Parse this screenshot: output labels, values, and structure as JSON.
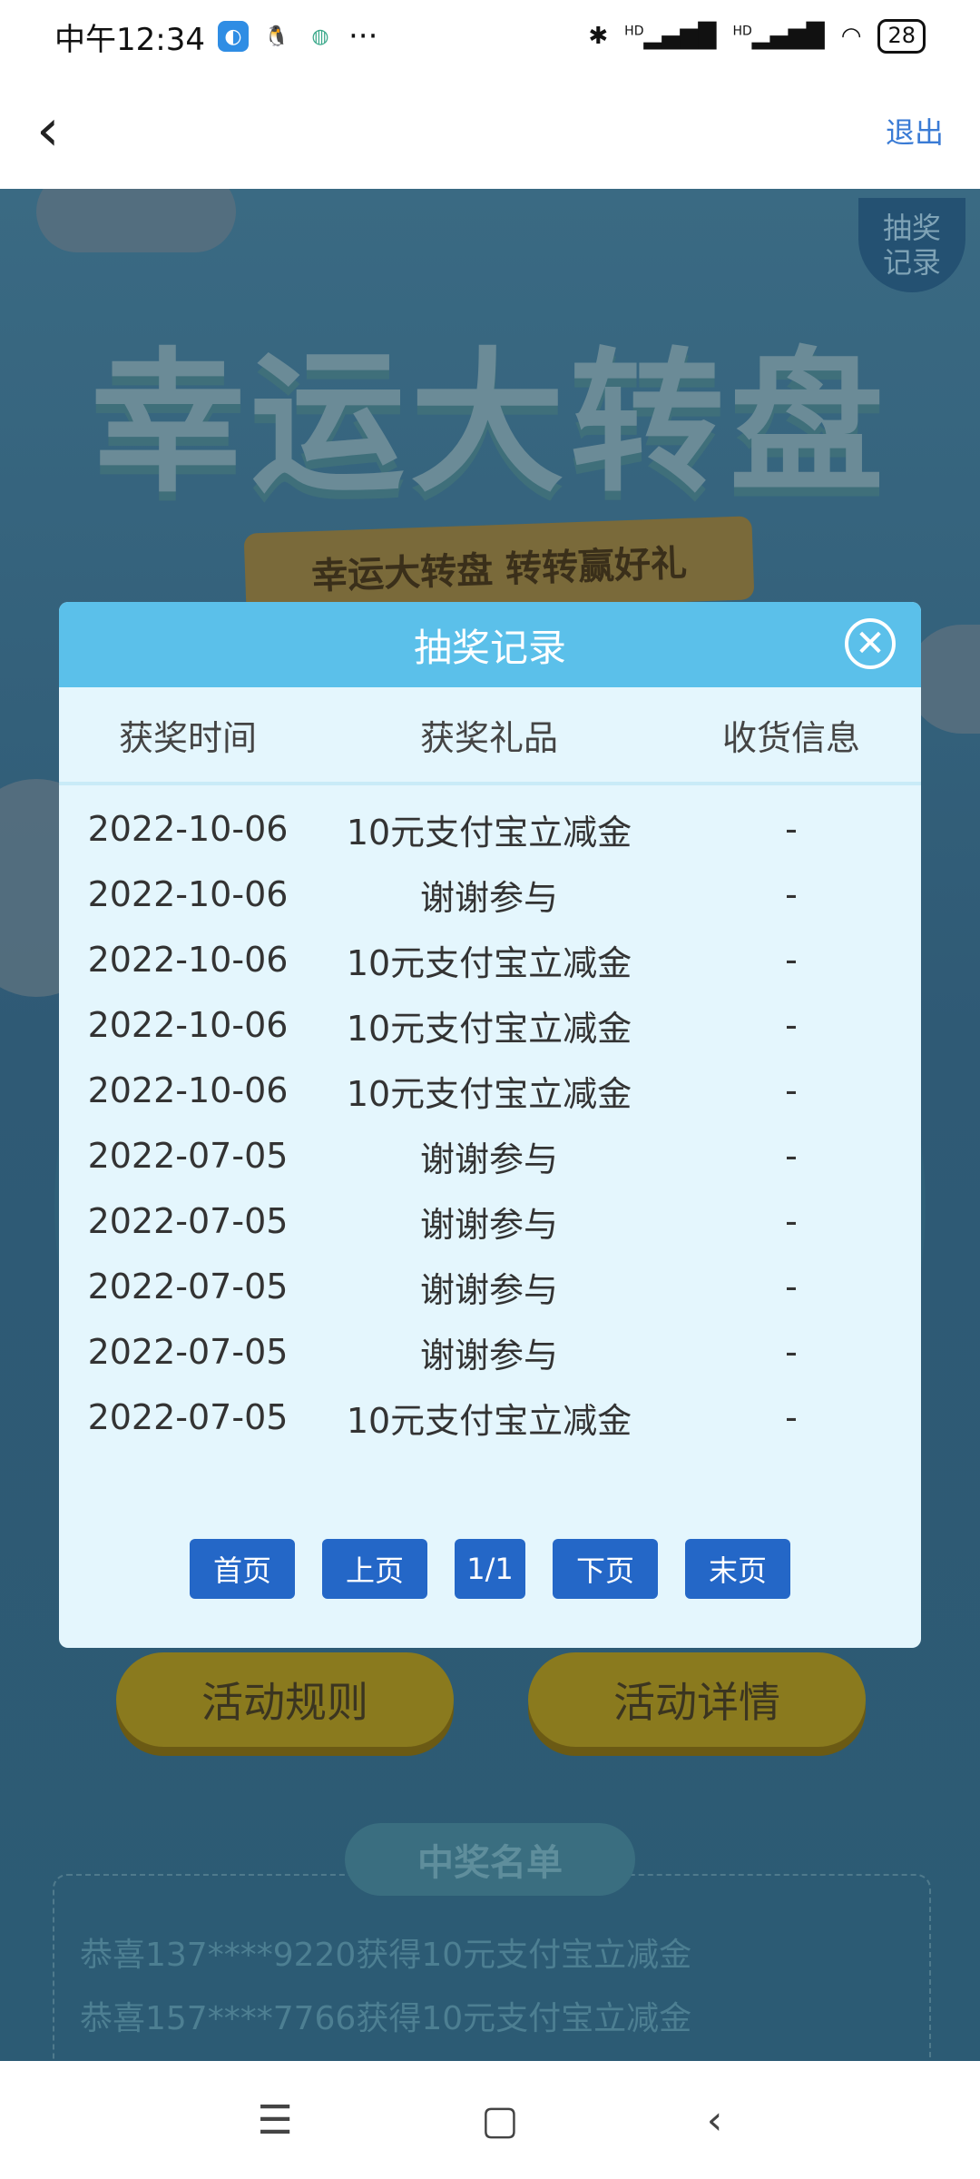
{
  "status_bar": {
    "time": "中午12:34",
    "more": "···",
    "battery": "28",
    "hd1": "HD",
    "hd2": "HD"
  },
  "header": {
    "back_icon": "‹",
    "exit_label": "退出"
  },
  "background": {
    "record_corner": "抽奖\n记录",
    "title": "幸运大转盘",
    "ribbon": "幸运大转盘 转转赢好礼",
    "rules_button": "活动规则",
    "details_button": "活动详情",
    "winners_title": "中奖名单",
    "winners": [
      "恭喜137****9220获得10元支付宝立减金",
      "恭喜157****7766获得10元支付宝立减金"
    ]
  },
  "modal": {
    "title": "抽奖记录",
    "columns": [
      "获奖时间",
      "获奖礼品",
      "收货信息"
    ],
    "rows": [
      [
        "2022-10-06",
        "10元支付宝立减金",
        "-"
      ],
      [
        "2022-10-06",
        "谢谢参与",
        "-"
      ],
      [
        "2022-10-06",
        "10元支付宝立减金",
        "-"
      ],
      [
        "2022-10-06",
        "10元支付宝立减金",
        "-"
      ],
      [
        "2022-10-06",
        "10元支付宝立减金",
        "-"
      ],
      [
        "2022-07-05",
        "谢谢参与",
        "-"
      ],
      [
        "2022-07-05",
        "谢谢参与",
        "-"
      ],
      [
        "2022-07-05",
        "谢谢参与",
        "-"
      ],
      [
        "2022-07-05",
        "谢谢参与",
        "-"
      ],
      [
        "2022-07-05",
        "10元支付宝立减金",
        "-"
      ]
    ],
    "pager": {
      "first": "首页",
      "prev": "上页",
      "page": "1/1",
      "next": "下页",
      "last": "末页"
    }
  },
  "colors": {
    "accent": "#2467c7",
    "modal_header": "#5bc0ea",
    "modal_bg": "#e4f6fd",
    "exit_link": "#3a7bd5"
  }
}
